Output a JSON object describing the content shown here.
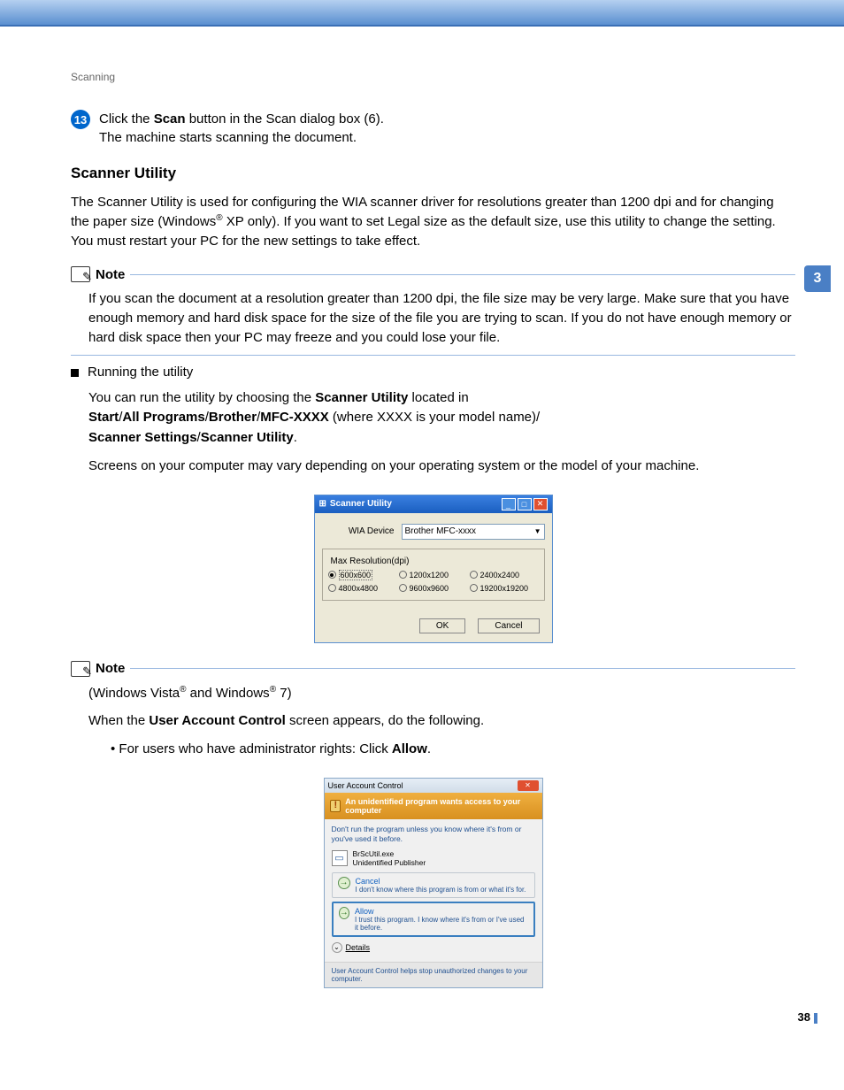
{
  "chapter_head": "Scanning",
  "side_tab": "3",
  "page_number": "38",
  "step13": {
    "num": "13",
    "line1_a": "Click the ",
    "line1_b": "Scan",
    "line1_c": " button in the Scan dialog box (6).",
    "line2": "The machine starts scanning the document."
  },
  "subhead": "Scanner Utility",
  "para1": "The Scanner Utility is used for configuring the WIA scanner driver for resolutions greater than 1200 dpi and for changing the paper size (Windows",
  "para1_sup": "®",
  "para1_b": " XP only). If you want to set Legal size as the default size, use this utility to change the setting. You must restart your PC for the new settings to take effect.",
  "note1": {
    "label": "Note",
    "body": "If you scan the document at a resolution greater than 1200 dpi, the file size may be very large. Make sure that you have enough memory and hard disk space for the size of the file you are trying to scan. If you do not have enough memory or hard disk space then your PC may freeze and you could lose your file."
  },
  "running": {
    "title": "Running the utility",
    "l1a": "You can run the utility by choosing the ",
    "l1b": "Scanner Utility",
    "l1c": " located in",
    "l2a": "Start",
    "l2b": "All Programs",
    "l2c": "Brother",
    "l2d": "MFC-XXXX",
    "l2e": " (where XXXX is your model name)/",
    "l3a": "Scanner Settings",
    "l3b": "Scanner Utility",
    "l4": "Screens on your computer may vary depending on your operating system or the model of your machine."
  },
  "su": {
    "title": "Scanner Utility",
    "wia_label": "WIA Device",
    "wia_value": "Brother MFC-xxxx",
    "fs_label": "Max Resolution(dpi)",
    "r1": "600x600",
    "r2": "1200x1200",
    "r3": "2400x2400",
    "r4": "4800x4800",
    "r5": "9600x9600",
    "r6": "19200x19200",
    "ok": "OK",
    "cancel": "Cancel"
  },
  "note2": {
    "label": "Note",
    "l1a": "(Windows Vista",
    "l1b": " and Windows",
    "l1c": " 7)",
    "l2a": "When the ",
    "l2b": "User Account Control",
    "l2c": " screen appears, do the following.",
    "bullet_a": "For users who have administrator rights: Click ",
    "bullet_b": "Allow",
    "bullet_c": "."
  },
  "uac": {
    "title": "User Account Control",
    "bar": "An unidentified program wants access to your computer",
    "msg": "Don't run the program unless you know where it's from or you've used it before.",
    "file_name": "BrScUtil.exe",
    "file_pub": "Unidentified Publisher",
    "cancel_t": "Cancel",
    "cancel_d": "I don't know where this program is from or what it's for.",
    "allow_t": "Allow",
    "allow_d": "I trust this program. I know where it's from or I've used it before.",
    "details": "Details",
    "foot": "User Account Control helps stop unauthorized changes to your computer."
  }
}
